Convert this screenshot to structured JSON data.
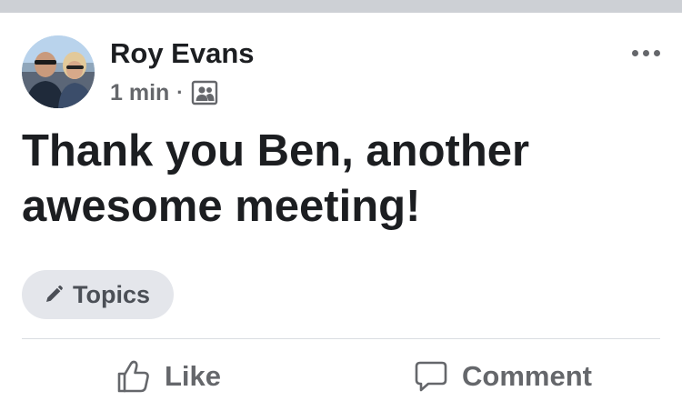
{
  "post": {
    "author": {
      "name": "Roy Evans"
    },
    "meta": {
      "time": "1 min",
      "separator": "·"
    },
    "audience_icon": "group-audience-icon",
    "more_icon": "ellipsis-icon",
    "text": "Thank you Ben, another awesome meeting!",
    "topics": {
      "icon": "pencil-icon",
      "label": "Topics"
    }
  },
  "actions": {
    "like": {
      "icon": "thumbs-up-icon",
      "label": "Like"
    },
    "comment": {
      "icon": "speech-bubble-icon",
      "label": "Comment"
    }
  },
  "colors": {
    "primary_text": "#1c1e21",
    "secondary_text": "#65676b",
    "chip_background": "#e4e6eb",
    "top_strip": "#cdd0d5",
    "divider": "#dadde1"
  }
}
